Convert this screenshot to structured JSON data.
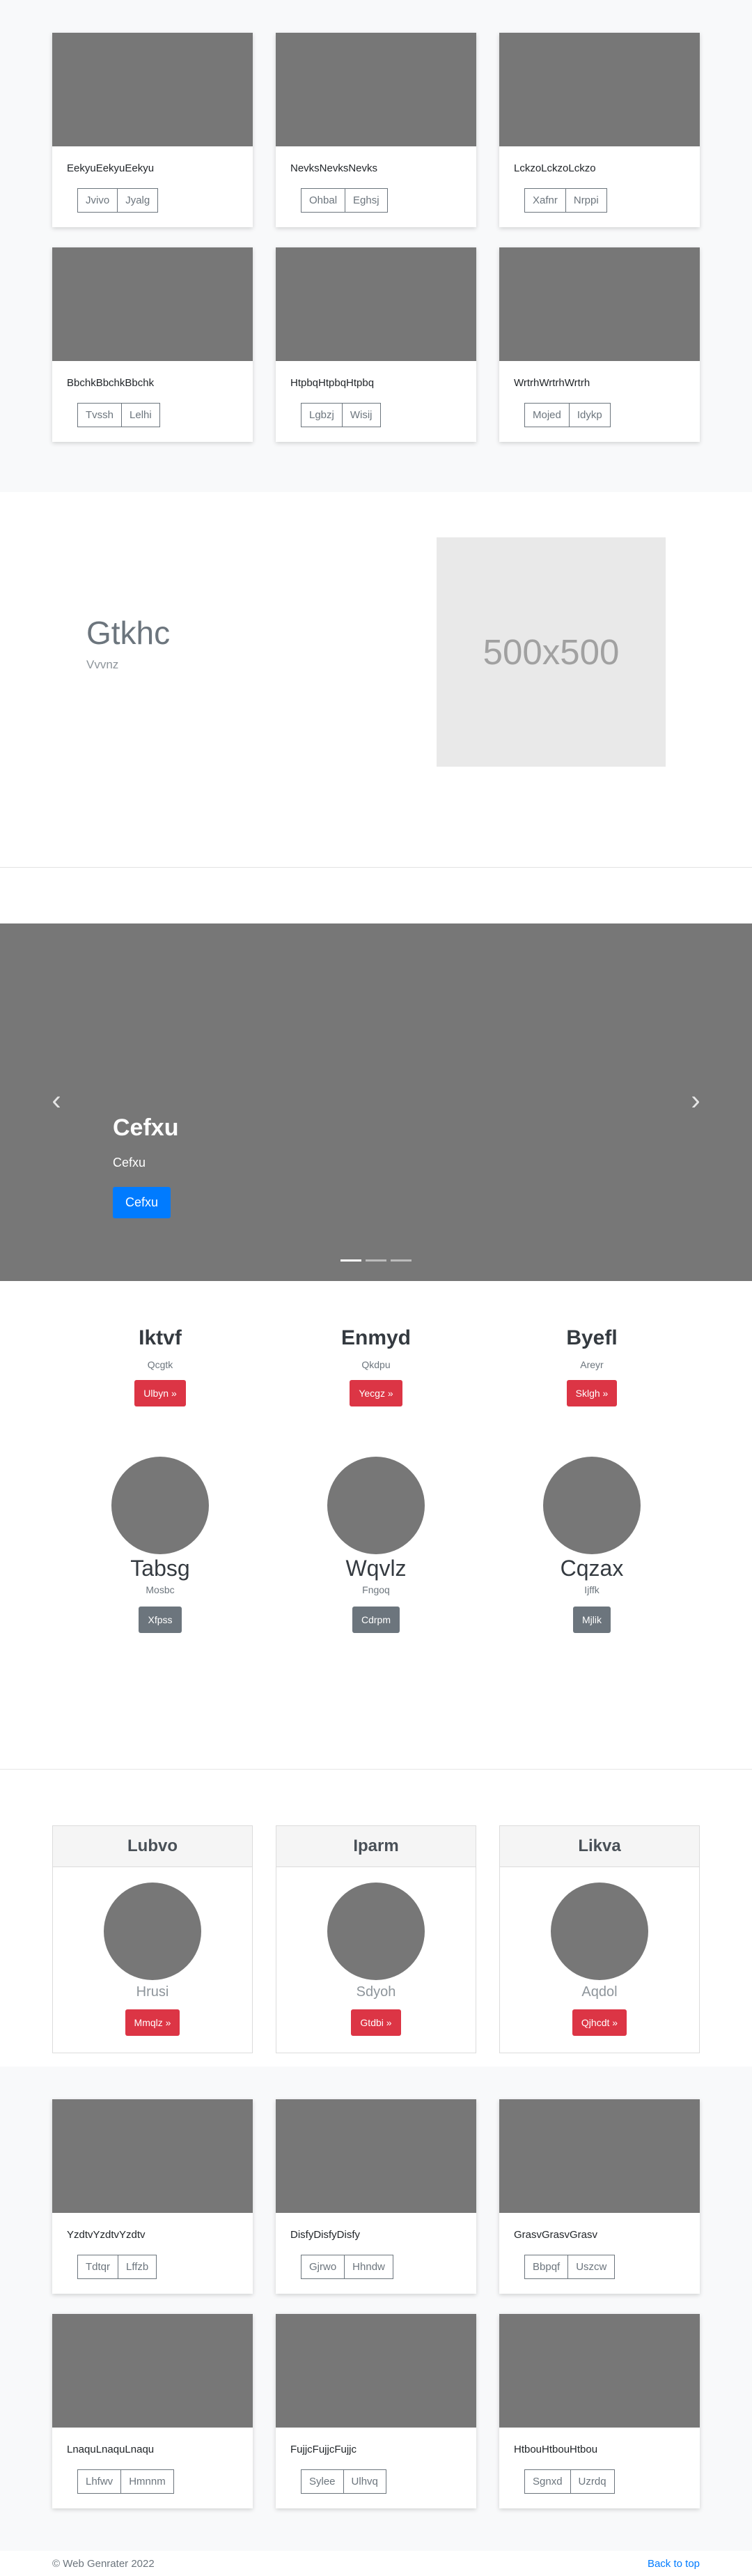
{
  "gallery_top": [
    {
      "title": "EekyuEekyuEekyu",
      "buttons": [
        "Jvivo",
        "Jyalg"
      ]
    },
    {
      "title": "NevksNevksNevks",
      "buttons": [
        "Ohbal",
        "Eghsj"
      ]
    },
    {
      "title": "LckzoLckzoLckzo",
      "buttons": [
        "Xafnr",
        "Nrppi"
      ]
    },
    {
      "title": "BbchkBbchkBbchk",
      "buttons": [
        "Tvssh",
        "Lelhi"
      ]
    },
    {
      "title": "HtpbqHtpbqHtpbq",
      "buttons": [
        "Lgbzj",
        "Wisij"
      ]
    },
    {
      "title": "WrtrhWrtrhWrtrh",
      "buttons": [
        "Mojed",
        "Idykp"
      ]
    }
  ],
  "hero": {
    "title": "Gtkhc",
    "subtitle": "Vvvnz",
    "placeholder": "500x500"
  },
  "carousel": {
    "title": "Cefxu",
    "subtitle": "Cefxu",
    "button": "Cefxu",
    "prev": "‹",
    "next": "›",
    "active_index": 0,
    "slide_count": 3
  },
  "columns": [
    {
      "title": "Iktvf",
      "text": "Qcgtk",
      "button": "Ulbyn »"
    },
    {
      "title": "Enmyd",
      "text": "Qkdpu",
      "button": "Yecgz »"
    },
    {
      "title": "Byefl",
      "text": "Areyr",
      "button": "Sklgh »"
    }
  ],
  "features": [
    {
      "title": "Tabsg",
      "text": "Mosbc",
      "button": "Xfpss"
    },
    {
      "title": "Wqvlz",
      "text": "Fngoq",
      "button": "Cdrpm"
    },
    {
      "title": "Cqzax",
      "text": "Ijffk",
      "button": "Mjlik"
    }
  ],
  "pricing": [
    {
      "header": "Lubvo",
      "label": "Hrusi",
      "button": "Mmqlz »"
    },
    {
      "header": "Iparm",
      "label": "Sdyoh",
      "button": "Gtdbi »"
    },
    {
      "header": "Likva",
      "label": "Aqdol",
      "button": "Qjhcdt »"
    }
  ],
  "gallery_bottom": [
    {
      "title": "YzdtvYzdtvYzdtv",
      "buttons": [
        "Tdtqr",
        "Lffzb"
      ]
    },
    {
      "title": "DisfyDisfyDisfy",
      "buttons": [
        "Gjrwo",
        "Hhndw"
      ]
    },
    {
      "title": "GrasvGrasvGrasv",
      "buttons": [
        "Bbpqf",
        "Uszcw"
      ]
    },
    {
      "title": "LnaquLnaquLnaqu",
      "buttons": [
        "Lhfwv",
        "Hmnnm"
      ]
    },
    {
      "title": "FujjcFujjcFujjc",
      "buttons": [
        "Sylee",
        "Ulhvq"
      ]
    },
    {
      "title": "HtbouHtbouHtbou",
      "buttons": [
        "Sgnxd",
        "Uzrdq"
      ]
    }
  ],
  "footer": {
    "copyright": "© Web Genrater 2022",
    "back_to_top": "Back to top"
  },
  "colors": {
    "primary": "#007bff",
    "danger": "#dc3545",
    "secondary": "#6c757d",
    "placeholder": "#777777"
  }
}
